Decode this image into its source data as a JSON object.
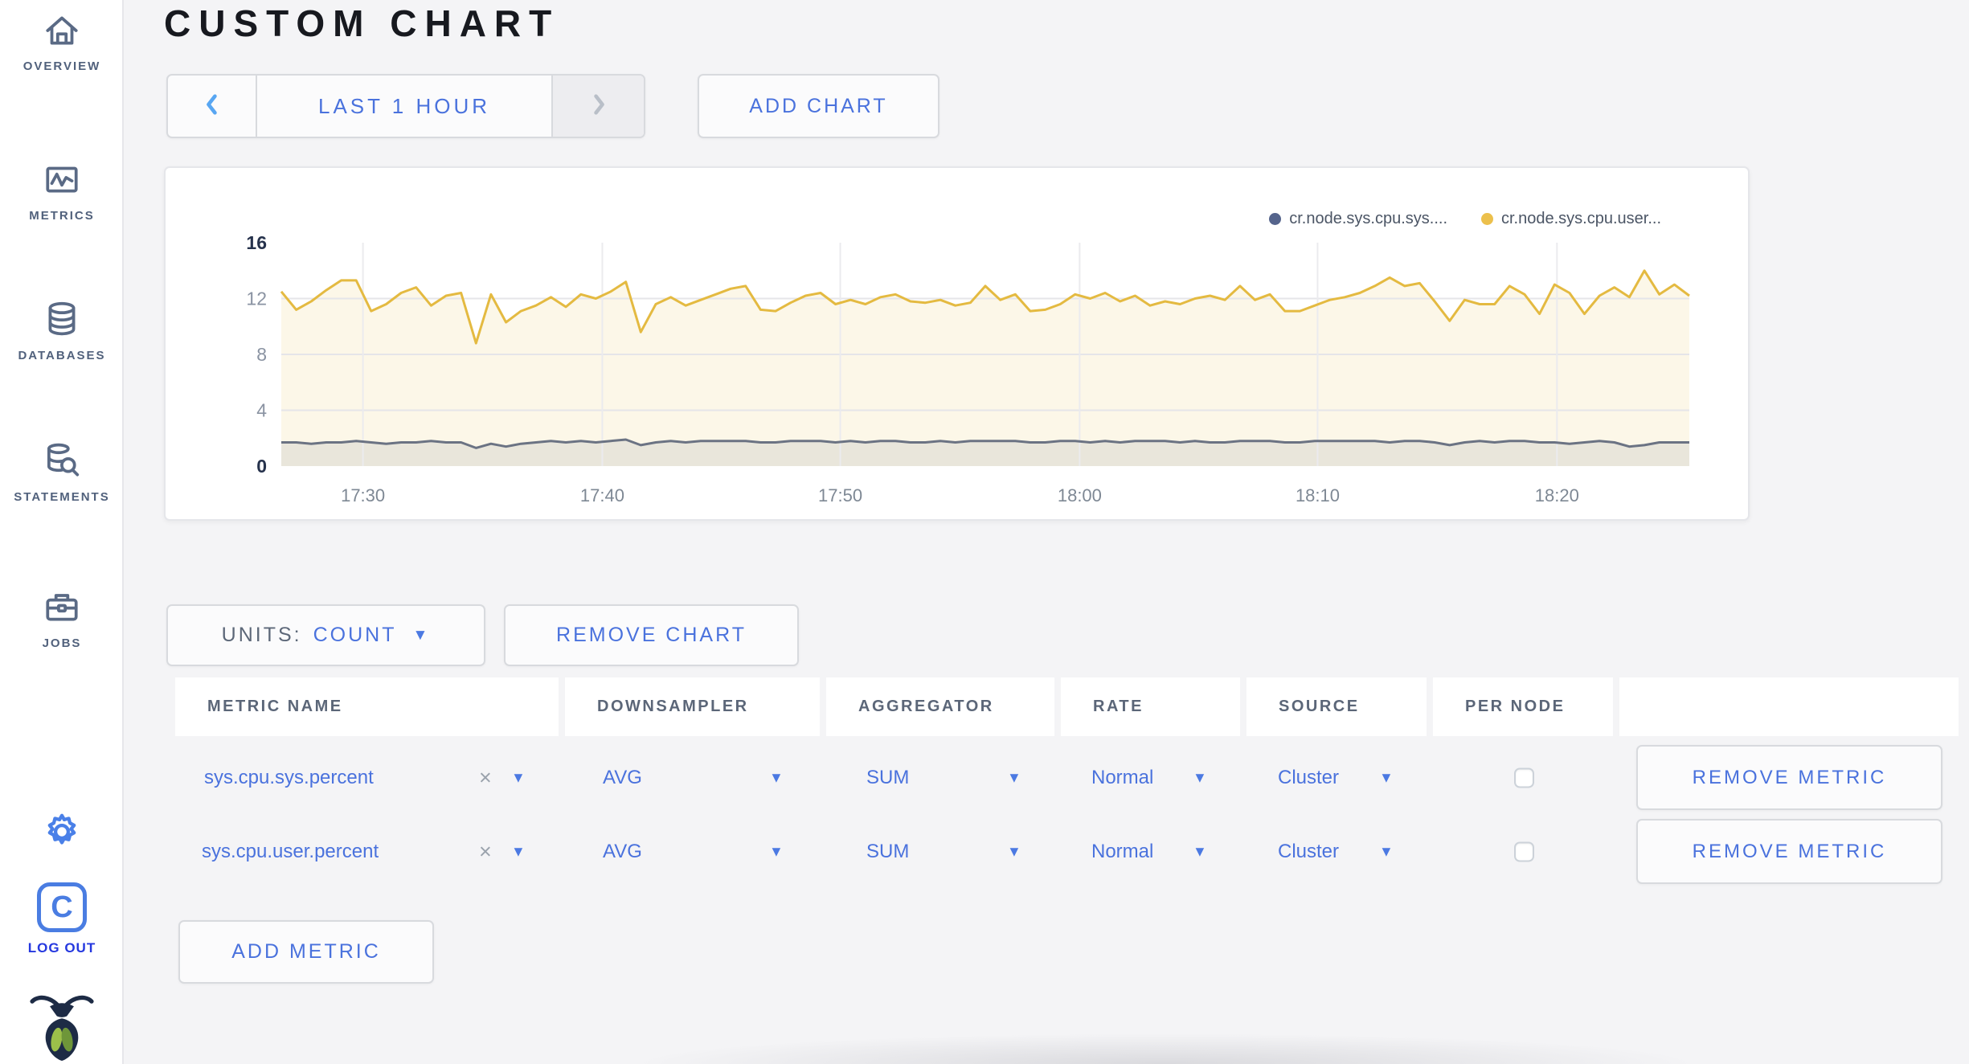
{
  "sidebar": {
    "items": [
      {
        "label": "OVERVIEW",
        "icon": "home-icon"
      },
      {
        "label": "METRICS",
        "icon": "metrics-icon"
      },
      {
        "label": "DATABASES",
        "icon": "database-icon"
      },
      {
        "label": "STATEMENTS",
        "icon": "statements-icon"
      },
      {
        "label": "JOBS",
        "icon": "briefcase-icon"
      }
    ],
    "logout_label": "LOG OUT",
    "logo_letter": "C"
  },
  "header": {
    "title": "CUSTOM CHART"
  },
  "toolbar": {
    "time_range_label": "LAST 1 HOUR",
    "add_chart_label": "ADD CHART"
  },
  "chart_controls": {
    "units_label": "UNITS:",
    "units_value": "COUNT",
    "remove_chart_label": "REMOVE CHART",
    "add_metric_label": "ADD METRIC"
  },
  "chart_data": {
    "type": "line",
    "title": "",
    "xlabel": "",
    "ylabel": "",
    "ylim": [
      0,
      16
    ],
    "y_ticks": [
      0,
      4,
      8,
      12,
      16
    ],
    "y_gridlines": [
      4,
      8,
      12
    ],
    "x_range": [
      "17:26",
      "18:25"
    ],
    "x_ticks": [
      {
        "label": "17:30",
        "f": 0.058
      },
      {
        "label": "17:40",
        "f": 0.228
      },
      {
        "label": "17:50",
        "f": 0.397
      },
      {
        "label": "18:00",
        "f": 0.567
      },
      {
        "label": "18:10",
        "f": 0.736
      },
      {
        "label": "18:20",
        "f": 0.906
      }
    ],
    "legend_position": "top-right",
    "grid": true,
    "series": [
      {
        "name": "cr.node.sys.cpu.sys....",
        "color": "#55648c",
        "line_color": "#6b7383",
        "fill_opacity": 0.13,
        "values": [
          1.7,
          1.7,
          1.6,
          1.7,
          1.7,
          1.8,
          1.7,
          1.6,
          1.7,
          1.7,
          1.8,
          1.7,
          1.7,
          1.3,
          1.6,
          1.4,
          1.6,
          1.7,
          1.8,
          1.7,
          1.8,
          1.7,
          1.8,
          1.9,
          1.5,
          1.7,
          1.8,
          1.7,
          1.8,
          1.8,
          1.8,
          1.8,
          1.7,
          1.7,
          1.8,
          1.8,
          1.8,
          1.7,
          1.8,
          1.7,
          1.8,
          1.8,
          1.7,
          1.7,
          1.8,
          1.7,
          1.8,
          1.8,
          1.8,
          1.8,
          1.7,
          1.7,
          1.8,
          1.8,
          1.7,
          1.8,
          1.7,
          1.8,
          1.8,
          1.8,
          1.7,
          1.8,
          1.7,
          1.7,
          1.8,
          1.8,
          1.8,
          1.7,
          1.7,
          1.8,
          1.8,
          1.8,
          1.8,
          1.8,
          1.7,
          1.8,
          1.8,
          1.7,
          1.5,
          1.7,
          1.8,
          1.7,
          1.8,
          1.8,
          1.7,
          1.7,
          1.6,
          1.7,
          1.8,
          1.7,
          1.4,
          1.5,
          1.7,
          1.7,
          1.7
        ]
      },
      {
        "name": "cr.node.sys.cpu.user...",
        "color": "#ecc04c",
        "line_color": "#e4ba41",
        "fill_opacity": 0.12,
        "values": [
          12.5,
          11.2,
          11.8,
          12.6,
          13.3,
          13.3,
          11.1,
          11.6,
          12.4,
          12.8,
          11.5,
          12.2,
          12.4,
          8.8,
          12.3,
          10.3,
          11.1,
          11.5,
          12.1,
          11.4,
          12.3,
          12.0,
          12.5,
          13.2,
          9.6,
          11.6,
          12.1,
          11.5,
          11.9,
          12.3,
          12.7,
          12.9,
          11.2,
          11.1,
          11.7,
          12.2,
          12.4,
          11.6,
          11.9,
          11.6,
          12.1,
          12.3,
          11.8,
          11.7,
          11.9,
          11.5,
          11.7,
          12.9,
          11.9,
          12.3,
          11.1,
          11.2,
          11.6,
          12.3,
          12.0,
          12.4,
          11.8,
          12.2,
          11.5,
          11.8,
          11.6,
          12.0,
          12.2,
          11.9,
          12.9,
          11.9,
          12.3,
          11.1,
          11.1,
          11.5,
          11.9,
          12.1,
          12.4,
          12.9,
          13.5,
          12.9,
          13.1,
          11.8,
          10.4,
          11.9,
          11.6,
          11.6,
          12.9,
          12.3,
          10.9,
          13.0,
          12.4,
          10.9,
          12.2,
          12.8,
          12.1,
          14.0,
          12.3,
          13.0,
          12.2
        ]
      }
    ]
  },
  "metrics_table": {
    "headers": [
      "METRIC NAME",
      "DOWNSAMPLER",
      "AGGREGATOR",
      "RATE",
      "SOURCE",
      "PER NODE",
      ""
    ],
    "remove_metric_label": "REMOVE METRIC",
    "rows": [
      {
        "metric": "sys.cpu.sys.percent",
        "downsampler": "AVG",
        "aggregator": "SUM",
        "rate": "Normal",
        "source": "Cluster",
        "per_node_checked": false
      },
      {
        "metric": "sys.cpu.user.percent",
        "downsampler": "AVG",
        "aggregator": "SUM",
        "rate": "Normal",
        "source": "Cluster",
        "per_node_checked": false
      }
    ]
  }
}
